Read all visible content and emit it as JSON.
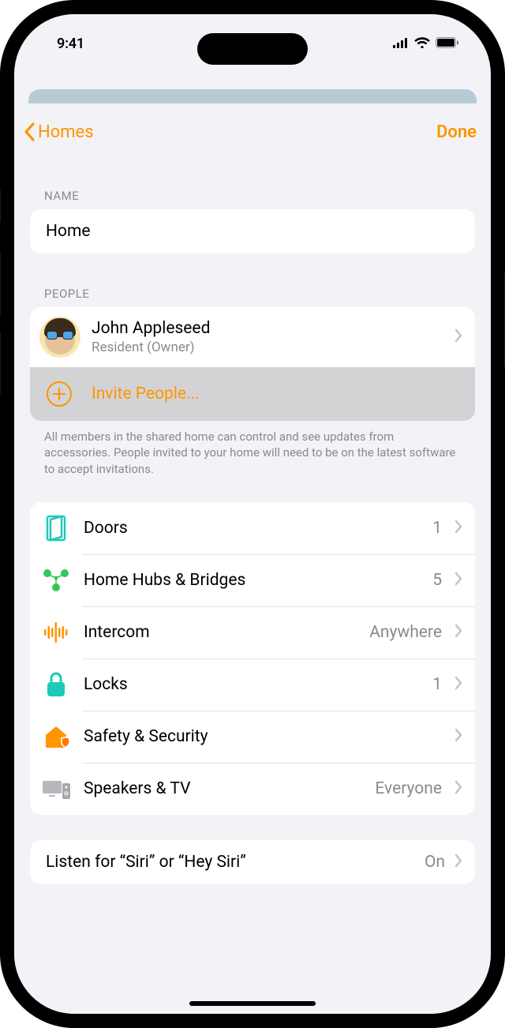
{
  "statusBar": {
    "time": "9:41"
  },
  "nav": {
    "back": "Homes",
    "done": "Done"
  },
  "sections": {
    "nameHeader": "NAME",
    "nameValue": "Home",
    "peopleHeader": "PEOPLE",
    "people": [
      {
        "name": "John Appleseed",
        "role": "Resident (Owner)"
      }
    ],
    "inviteLabel": "Invite People...",
    "peopleFooter": "All members in the shared home can control and see updates from accessories. People invited to your home will need to be on the latest software to accept invitations."
  },
  "accessories": [
    {
      "label": "Doors",
      "value": "1"
    },
    {
      "label": "Home Hubs & Bridges",
      "value": "5"
    },
    {
      "label": "Intercom",
      "value": "Anywhere"
    },
    {
      "label": "Locks",
      "value": "1"
    },
    {
      "label": "Safety & Security",
      "value": ""
    },
    {
      "label": "Speakers & TV",
      "value": "Everyone"
    }
  ],
  "siri": {
    "label": "Listen for “Siri” or “Hey Siri”",
    "value": "On"
  }
}
